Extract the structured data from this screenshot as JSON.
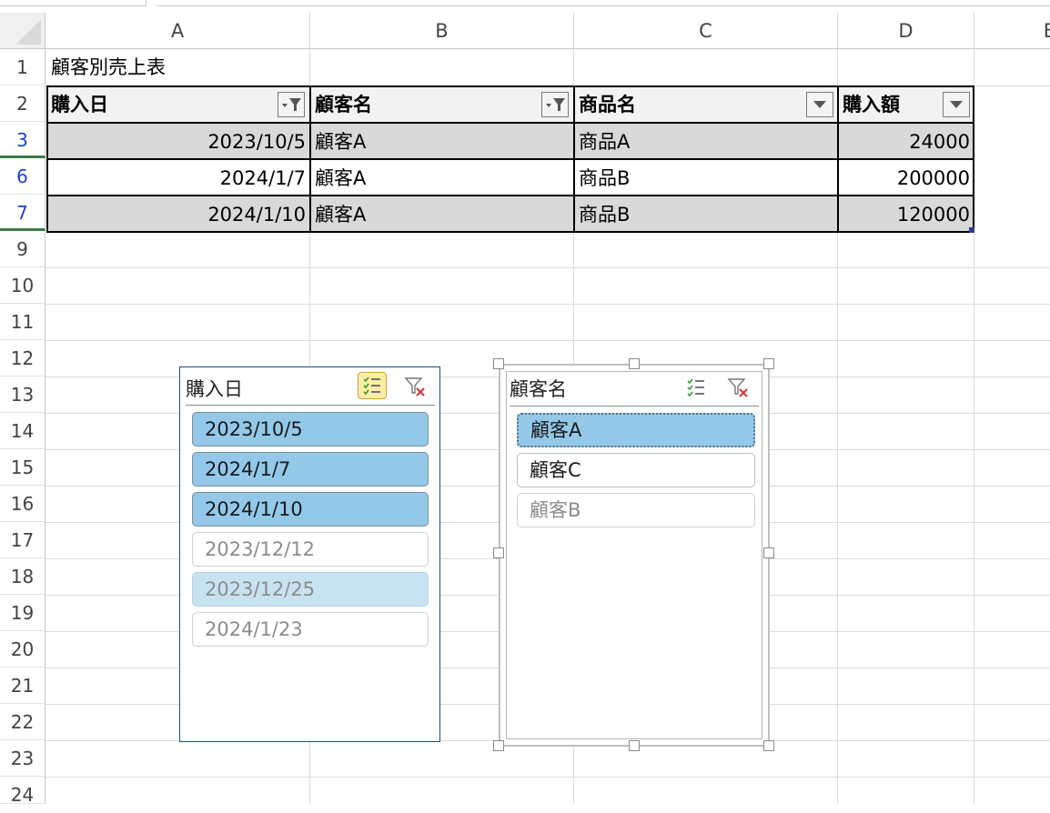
{
  "columns": [
    "A",
    "B",
    "C",
    "D",
    "E"
  ],
  "rows": [
    "1",
    "2",
    "3",
    "6",
    "7",
    "9",
    "10",
    "11",
    "12",
    "13",
    "14",
    "15",
    "16",
    "17",
    "18",
    "19",
    "20",
    "21",
    "22",
    "23",
    "24"
  ],
  "sheet": {
    "title": "顧客別売上表",
    "headers": [
      "購入日",
      "顧客名",
      "商品名",
      "購入額"
    ],
    "data": [
      [
        "2023/10/5",
        "顧客A",
        "商品A",
        "24000"
      ],
      [
        "2024/1/7",
        "顧客A",
        "商品B",
        "200000"
      ],
      [
        "2024/1/10",
        "顧客A",
        "商品B",
        "120000"
      ]
    ]
  },
  "slicer_date": {
    "title": "購入日",
    "items": [
      "2023/10/5",
      "2024/1/7",
      "2024/1/10",
      "2023/12/12",
      "2023/12/25",
      "2024/1/23"
    ]
  },
  "slicer_customer": {
    "title": "顧客名",
    "items": [
      "顧客A",
      "顧客C",
      "顧客B"
    ]
  },
  "colors": {
    "selected_item": "#93c8e9",
    "row_highlight": "#d9d9d9",
    "selected_row_number": "#1f3fd1",
    "hidden_rows_marker": "#3f7a4a"
  }
}
